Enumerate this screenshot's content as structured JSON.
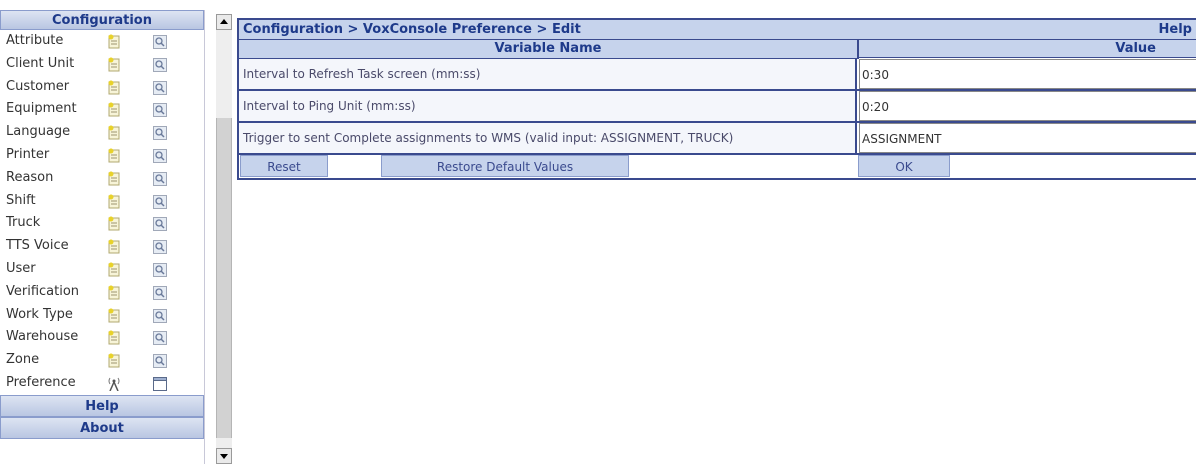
{
  "sidebar": {
    "header": "Configuration",
    "items": [
      {
        "label": "Attribute"
      },
      {
        "label": "Client Unit"
      },
      {
        "label": "Customer"
      },
      {
        "label": "Equipment"
      },
      {
        "label": "Language"
      },
      {
        "label": "Printer"
      },
      {
        "label": "Reason"
      },
      {
        "label": "Shift"
      },
      {
        "label": "Truck"
      },
      {
        "label": "TTS Voice"
      },
      {
        "label": "User"
      },
      {
        "label": "Verification"
      },
      {
        "label": "Work Type"
      },
      {
        "label": "Warehouse"
      },
      {
        "label": "Zone"
      },
      {
        "label": "Preference"
      }
    ],
    "footer_help": "Help",
    "footer_about": "About"
  },
  "panel": {
    "breadcrumb": "Configuration > VoxConsole Preference > Edit",
    "help": "Help",
    "columns": {
      "name": "Variable Name",
      "value": "Value"
    },
    "rows": [
      {
        "name": "Interval to Refresh Task screen (mm:ss)",
        "value": "0:30"
      },
      {
        "name": "Interval to Ping Unit (mm:ss)",
        "value": "0:20"
      },
      {
        "name": "Trigger to sent Complete assignments to WMS (valid input: ASSIGNMENT, TRUCK)",
        "value": "ASSIGNMENT"
      }
    ],
    "buttons": {
      "reset": "Reset",
      "restore": "Restore Default Values",
      "ok": "OK"
    }
  },
  "colors": {
    "accent": "#3a4a8e",
    "header_bg": "#c6d3ec",
    "title_text": "#1e3a8a"
  },
  "icons": {
    "add": "add-document-icon",
    "view": "magnifier-view-icon",
    "preference": "antenna-icon",
    "preference_view": "window-icon"
  }
}
